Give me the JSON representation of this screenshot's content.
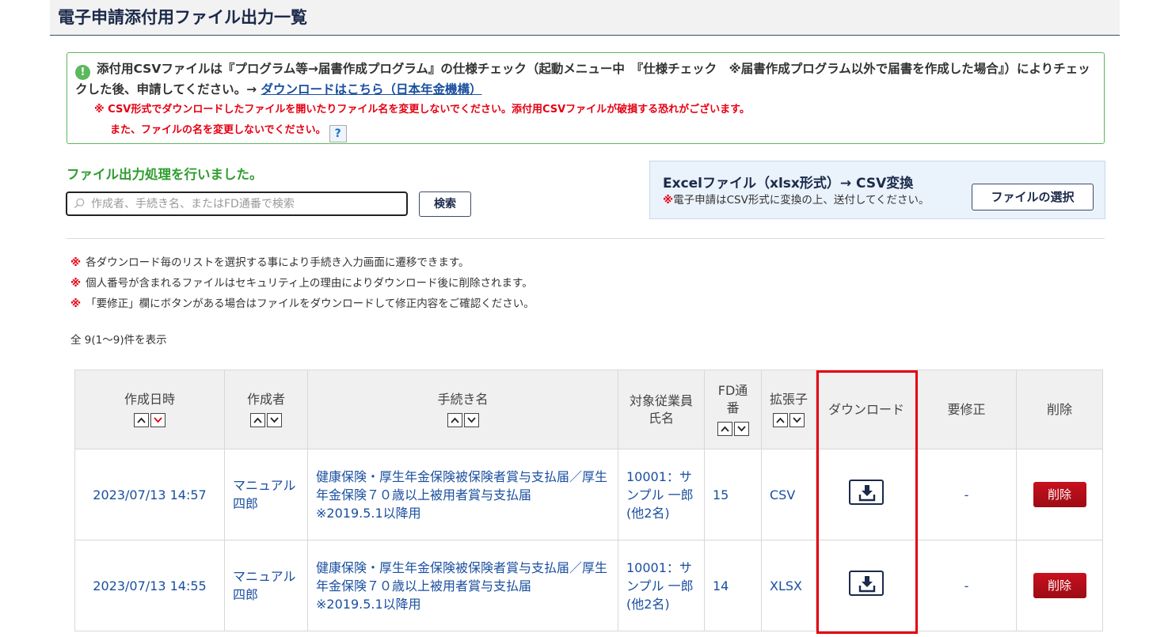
{
  "header": {
    "title": "電子申請添付用ファイル出力一覧"
  },
  "notice": {
    "line1_pre": "添付用CSVファイルは『プログラム等→届書作成プログラム』の仕様チェック（起動メニュー中　『仕様チェック　※届書作成プログラム以外で届書を作成した場合』）によりチェックした後、申請してください。→ ",
    "link": "ダウンロードはこちら（日本年金機構）",
    "red1": "※ CSV形式でダウンロードしたファイルを開いたりファイル名を変更しないでください。添付用CSVファイルが破損する恐れがございます。",
    "red2": "また、ファイルの名を変更しないでください。",
    "help": "?"
  },
  "status_message": "ファイル出力処理を行いました。",
  "search": {
    "placeholder": "作成者、手続き名、またはFD通番で検索",
    "value": "",
    "button": "検索"
  },
  "excel_panel": {
    "title": "Excelファイル（xlsx形式）→ CSV変換",
    "mark": "※",
    "note": "電子申請はCSV形式に変換の上、送付してください。",
    "button": "ファイルの選択"
  },
  "notes": [
    {
      "mark": "※",
      "text": "各ダウンロード毎のリストを選択する事により手続き入力画面に遷移できます。"
    },
    {
      "mark": "※",
      "text": "個人番号が含まれるファイルはセキュリティ上の理由によりダウンロード後に削除されます。"
    },
    {
      "mark": "※",
      "text": "「要修正」欄にボタンがある場合はファイルをダウンロードして修正内容をご確認ください。"
    }
  ],
  "count_text": "全 9(1〜9)件を表示",
  "table": {
    "headers": {
      "date": "作成日時",
      "creator": "作成者",
      "procedure": "手続き名",
      "employee_l1": "対象従業員",
      "employee_l2": "氏名",
      "fd_l1": "FD通",
      "fd_l2": "番",
      "ext": "拡張子",
      "download": "ダウンロード",
      "fix": "要修正",
      "delete": "削除"
    },
    "rows": [
      {
        "date": "2023/07/13 14:57",
        "creator": "マニュアル四郎",
        "procedure": "健康保険・厚生年金保険被保険者賞与支払届／厚生年金保険７０歳以上被用者賞与支払届",
        "procedure_note": "※2019.5.1以降用",
        "employee": "10001：サンプル 一郎",
        "employee_other": "(他2名)",
        "fd": "15",
        "ext": "CSV",
        "fix": "-",
        "delete": "削除"
      },
      {
        "date": "2023/07/13 14:55",
        "creator": "マニュアル四郎",
        "procedure": "健康保険・厚生年金保険被保険者賞与支払届／厚生年金保険７０歳以上被用者賞与支払届",
        "procedure_note": "※2019.5.1以降用",
        "employee": "10001：サンプル 一郎",
        "employee_other": "(他2名)",
        "fd": "14",
        "ext": "XLSX",
        "fix": "-",
        "delete": "削除"
      }
    ]
  },
  "colors": {
    "accent_red": "#e60012",
    "link_blue": "#1a4fa0",
    "success_green": "#2e9d2e",
    "navy": "#1b2a4a"
  }
}
